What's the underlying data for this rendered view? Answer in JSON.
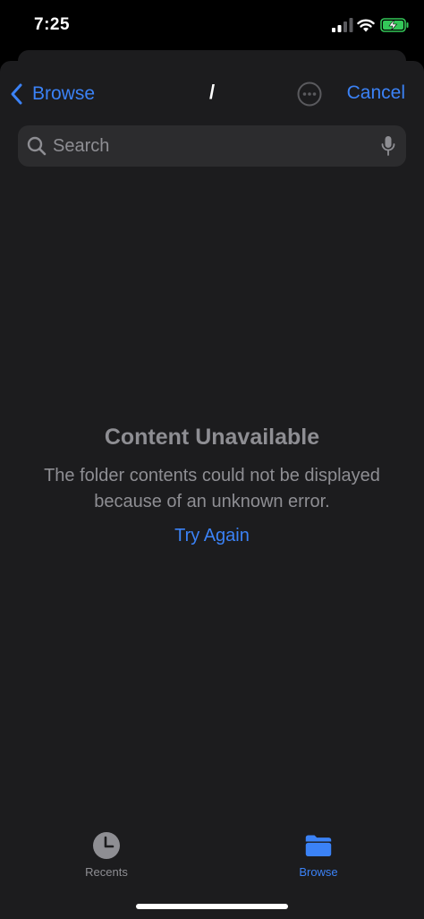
{
  "status_bar": {
    "time": "7:25"
  },
  "nav": {
    "back_label": "Browse",
    "title": "/",
    "cancel_label": "Cancel"
  },
  "search": {
    "placeholder": "Search"
  },
  "empty_state": {
    "title": "Content Unavailable",
    "message": "The folder contents could not be displayed because of an unknown error.",
    "action_label": "Try Again"
  },
  "tab_bar": {
    "tabs": [
      {
        "label": "Recents",
        "icon": "clock-icon",
        "selected": false
      },
      {
        "label": "Browse",
        "icon": "folder-icon",
        "selected": true
      }
    ]
  },
  "colors": {
    "accent": "#3b82f6",
    "sheet_background": "#1c1c1e",
    "search_background": "#2c2c2e",
    "secondary_text": "#8e8e93",
    "battery_charging": "#34c759"
  }
}
